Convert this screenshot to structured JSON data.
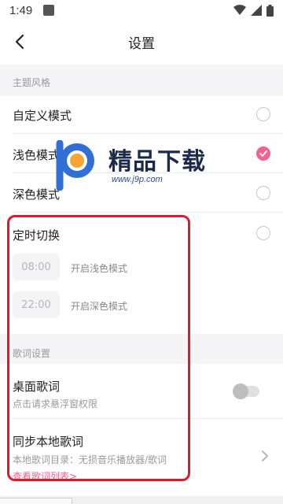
{
  "status_bar": {
    "time": "1:49"
  },
  "nav": {
    "title": "设置"
  },
  "theme_section": {
    "header": "主题风格",
    "options": [
      {
        "label": "自定义模式",
        "checked": false
      },
      {
        "label": "浅色模式",
        "checked": true
      },
      {
        "label": "深色模式",
        "checked": false
      }
    ]
  },
  "schedule": {
    "label": "定时切换",
    "checked": false,
    "light": {
      "time": "08:00",
      "desc": "开启浅色模式"
    },
    "dark": {
      "time": "22:00",
      "desc": "开启深色模式"
    }
  },
  "lyrics_section": {
    "header": "歌词设置",
    "desktop": {
      "title": "桌面歌词",
      "subtitle": "点击请求悬浮窗权限",
      "enabled": false
    },
    "sync": {
      "title": "同步本地歌词",
      "subtitle": "本地歌词目录：无损音乐播放器/歌词",
      "link": "查看歌词列表>"
    }
  },
  "watermark": {
    "title": "精品下载",
    "url": "www.j9p.com"
  },
  "colors": {
    "accent": "#f06292",
    "highlight": "#e0192d"
  }
}
